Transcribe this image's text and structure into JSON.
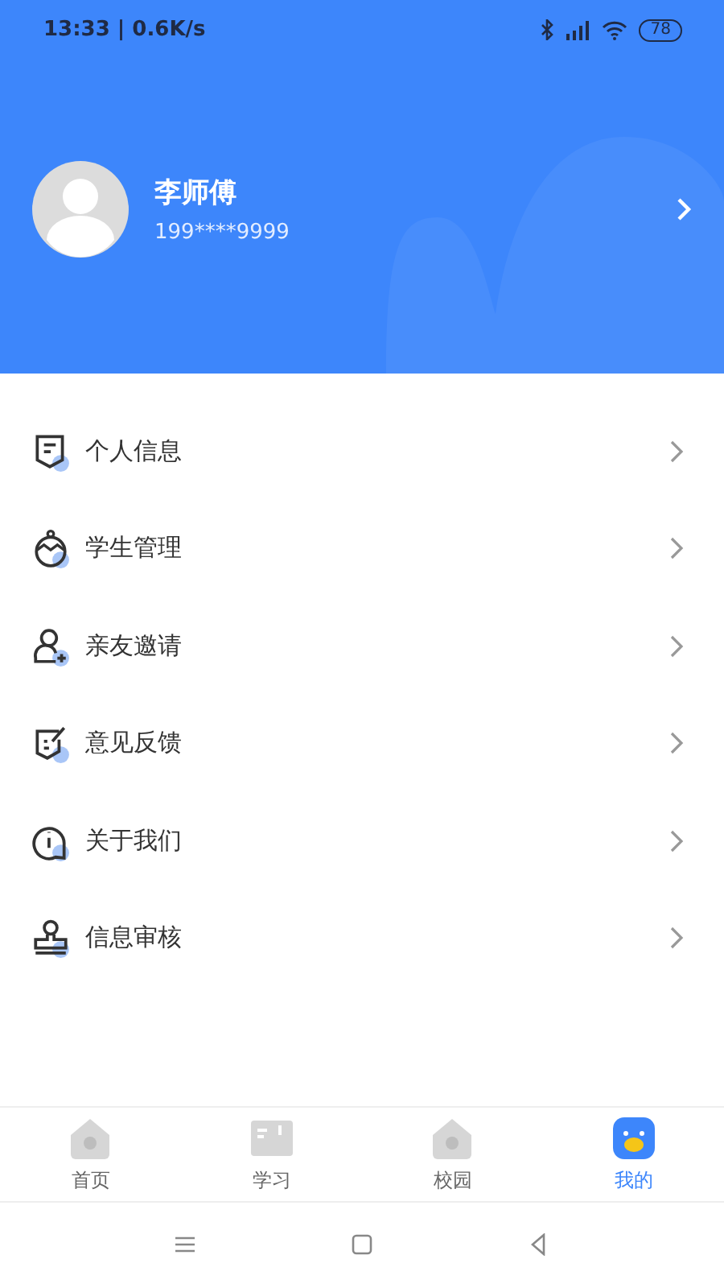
{
  "status_bar": {
    "time": "13:33 | 0.6K/s",
    "battery": "78"
  },
  "profile": {
    "name": "李师傅",
    "phone": "199****9999"
  },
  "menu": [
    {
      "label": "个人信息",
      "kind": "document"
    },
    {
      "label": "学生管理",
      "kind": "bag"
    },
    {
      "label": "亲友邀请",
      "kind": "person-add"
    },
    {
      "label": "意见反馈",
      "kind": "feedback"
    },
    {
      "label": "关于我们",
      "kind": "info"
    },
    {
      "label": "信息审核",
      "kind": "stamp"
    }
  ],
  "tabs": [
    {
      "label": "首页",
      "kind": "house",
      "selected": false
    },
    {
      "label": "学习",
      "kind": "book",
      "selected": false
    },
    {
      "label": "校园",
      "kind": "house",
      "selected": false
    },
    {
      "label": "我的",
      "kind": "face",
      "selected": true
    }
  ]
}
